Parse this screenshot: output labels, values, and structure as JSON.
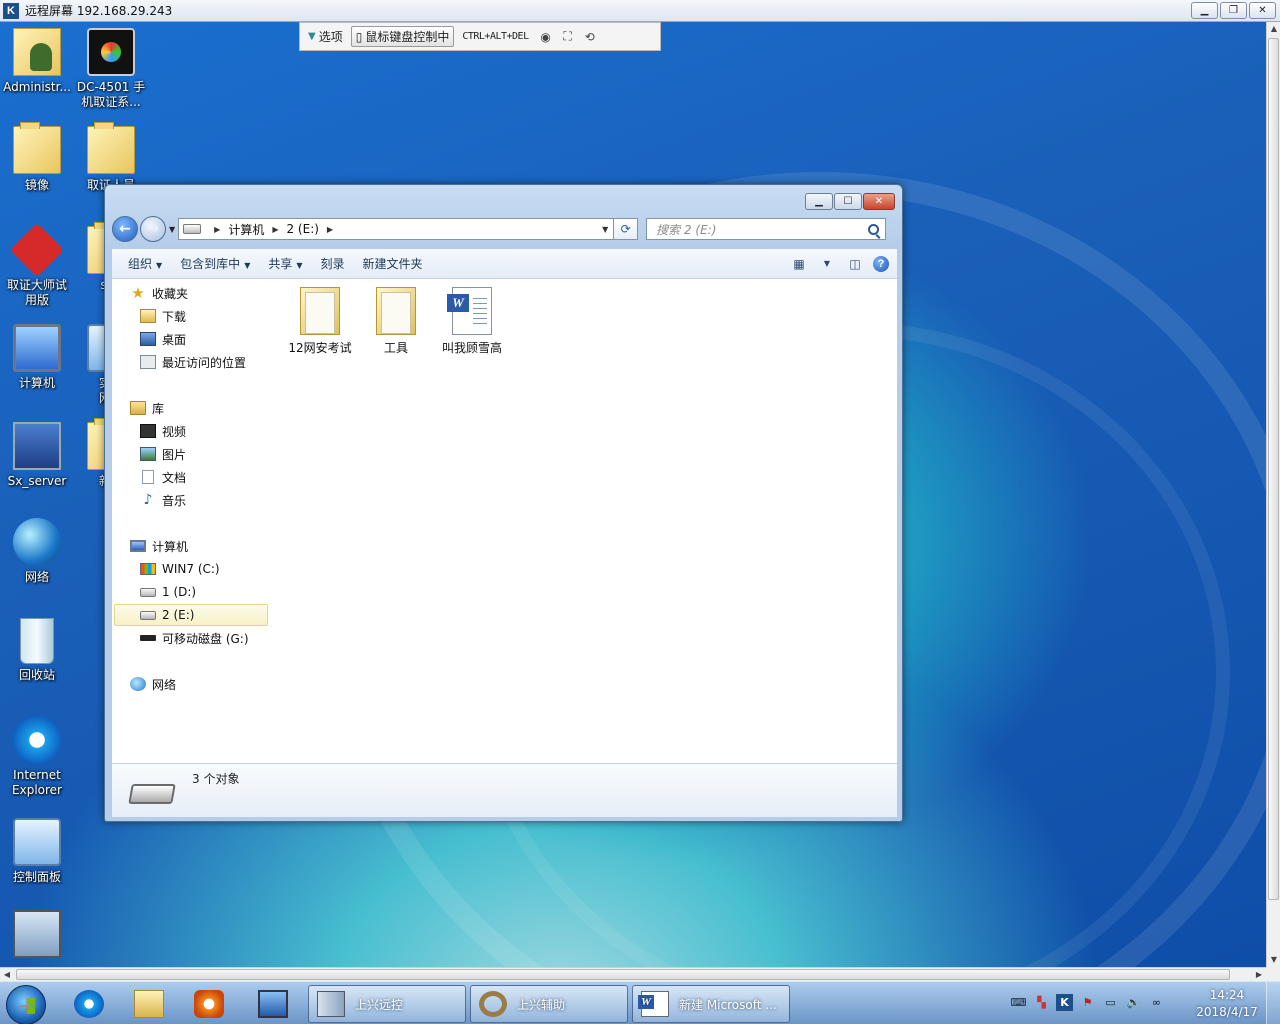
{
  "remote_window": {
    "title": "远程屏幕 192.168.29.243",
    "app_icon_glyph": "K"
  },
  "remote_toolbar": {
    "options_label": "选项",
    "mouse_keyboard_label": "鼠标键盘控制中",
    "cad_label": "CTRL+ALT+DEL"
  },
  "desktop_icons": {
    "administrator": "Administr...",
    "dc4501_line1": "DC-4501 手",
    "dc4501_line2": "机取证系...",
    "mirror": "镜像",
    "evidence_folder": "取证人员",
    "forensics_master_line1": "取证大师试",
    "forensics_master_line2": "用版",
    "she": "she",
    "computer": "计算机",
    "lab_line1": "实验",
    "lab_line2": "网络",
    "sx_server": "Sx_server",
    "new_item": "新建",
    "network": "网络",
    "recycle_bin": "回收站",
    "ie_line1": "Internet",
    "ie_line2": "Explorer",
    "control_panel": "控制面板"
  },
  "explorer": {
    "breadcrumb": [
      "计算机",
      "2 (E:)"
    ],
    "search_placeholder": "搜索 2 (E:)",
    "commands": {
      "organize": "组织",
      "include_in_library": "包含到库中",
      "share": "共享",
      "burn": "刻录",
      "new_folder": "新建文件夹"
    },
    "nav": {
      "favorites": "收藏夹",
      "downloads": "下载",
      "desktop": "桌面",
      "recent_places": "最近访问的位置",
      "libraries": "库",
      "videos": "视频",
      "pictures": "图片",
      "documents": "文档",
      "music": "音乐",
      "computer": "计算机",
      "drive_c": "WIN7 (C:)",
      "drive_d": "1 (D:)",
      "drive_e": "2 (E:)",
      "drive_g": "可移动磁盘 (G:)",
      "network": "网络"
    },
    "files": [
      {
        "name": "12网安考试",
        "type": "folder"
      },
      {
        "name": "工具",
        "type": "folder"
      },
      {
        "name": "叫我顾雪高",
        "type": "word-document"
      }
    ],
    "status": "3 个对象"
  },
  "taskbar": {
    "tasks": {
      "remote_control": "上兴远控",
      "helper": "上兴辅助",
      "word": "新建 Microsoft ..."
    },
    "clock_time": "14:24",
    "clock_date": "2018/4/17"
  }
}
